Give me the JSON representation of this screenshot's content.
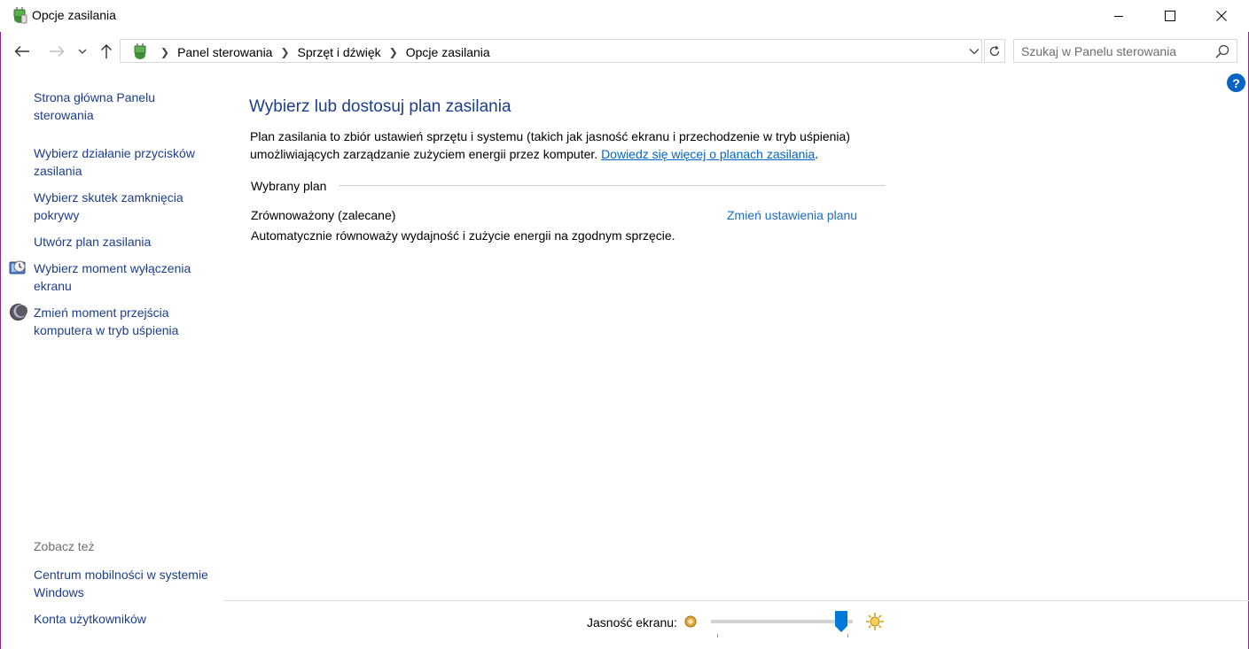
{
  "window": {
    "title": "Opcje zasilania",
    "minimize_icon": "minimize-icon",
    "maximize_icon": "maximize-icon",
    "close_icon": "close-icon"
  },
  "nav": {
    "back_icon": "arrow-left-icon",
    "forward_icon": "arrow-right-icon",
    "recent_icon": "chevron-down-icon",
    "up_icon": "arrow-up-icon"
  },
  "breadcrumb": {
    "items": [
      "Panel sterowania",
      "Sprzęt i dźwięk",
      "Opcje zasilania"
    ]
  },
  "search": {
    "placeholder": "Szukaj w Panelu sterowania"
  },
  "sidebar": {
    "items": [
      {
        "label": "Strona główna Panelu sterowania"
      },
      {
        "label": "Wybierz działanie przycisków zasilania"
      },
      {
        "label": "Wybierz skutek zamknięcia pokrywy"
      },
      {
        "label": "Utwórz plan zasilania"
      },
      {
        "label": "Wybierz moment wyłączenia ekranu",
        "icon": "monitor-clock-icon"
      },
      {
        "label": "Zmień moment przejścia komputera w tryb uśpienia",
        "icon": "moon-icon"
      }
    ],
    "see_also_label": "Zobacz też",
    "see_also": [
      {
        "label": "Centrum mobilności w systemie Windows"
      },
      {
        "label": "Konta użytkowników"
      }
    ]
  },
  "main": {
    "title": "Wybierz lub dostosuj plan zasilania",
    "description": "Plan zasilania to zbiór ustawień sprzętu i systemu (takich jak jasność ekranu i przechodzenie w tryb uśpienia) umożliwiających zarządzanie zużyciem energii przez komputer.",
    "learn_more": "Dowiedz się więcej o planach zasilania",
    "learn_more_suffix": ".",
    "group_label": "Wybrany plan",
    "plan_name": "Zrównoważony (zalecane)",
    "plan_change_link": "Zmień ustawienia planu",
    "plan_description": "Automatycznie równoważy wydajność i zużycie energii na zgodnym sprzęcie."
  },
  "brightness": {
    "label": "Jasność ekranu:",
    "value_percent": 100
  },
  "colors": {
    "link": "#1c3d8e",
    "accent": "#0078d7",
    "help": "#0a62c4"
  }
}
